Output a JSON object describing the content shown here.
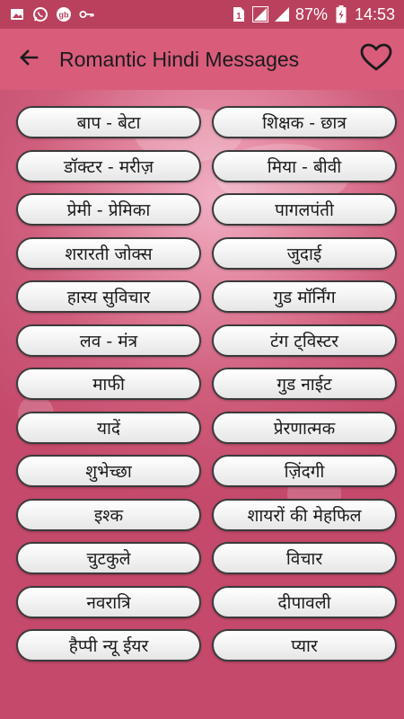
{
  "status_bar": {
    "battery_percent": "87%",
    "time": "14:53",
    "icons": [
      "gallery-icon",
      "whatsapp-icon",
      "gb-icon",
      "key-icon",
      "sim-icon",
      "signal-icon",
      "battery-icon"
    ],
    "sim_label": "1"
  },
  "app_bar": {
    "title": "Romantic Hindi Messages",
    "back_icon": "back-arrow-icon",
    "favorite_icon": "heart-icon"
  },
  "categories": [
    "बाप - बेटा",
    "शिक्षक - छात्र",
    "डॉक्टर - मरीज़",
    "मिया - बीवी",
    "प्रेमी - प्रेमिका",
    "पागलपंती",
    "शरारती जोक्स",
    "जुदाई",
    "हास्य सुविचार",
    "गुड मॉर्निंग",
    "लव - मंत्र",
    "टंग ट्विस्टर",
    "माफी",
    "गुड नाईट",
    "यादें",
    "प्रेरणात्मक",
    "शुभेच्छा",
    "ज़िंदगी",
    "इश्क",
    "शायरों की मेहफिल",
    "चुटकुले",
    "विचार",
    "नवरात्रि",
    "दीपावली",
    "हैप्पी न्यू ईयर",
    "प्यार"
  ],
  "colors": {
    "status_bar": "#b9415d",
    "app_bar": "#d95c7b",
    "background": "#c64a68"
  }
}
